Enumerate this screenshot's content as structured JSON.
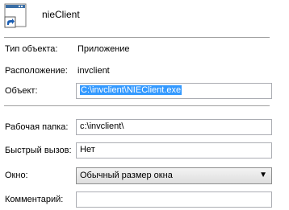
{
  "header": {
    "app_name": "nieClient",
    "icon": "shortcut-app-icon"
  },
  "info": {
    "type_label": "Тип объекта:",
    "type_value": "Приложение",
    "location_label": "Расположение:",
    "location_value": "invclient",
    "target_label": "Объект:",
    "target_value": "C:\\invclient\\NIEClient.exe"
  },
  "fields": {
    "workdir_label": "Рабочая папка:",
    "workdir_value": "c:\\invclient\\",
    "hotkey_label": "Быстрый вызов:",
    "hotkey_value": "Нет",
    "window_label": "Окно:",
    "window_value": "Обычный размер окна",
    "comment_label": "Комментарий:",
    "comment_value": ""
  }
}
